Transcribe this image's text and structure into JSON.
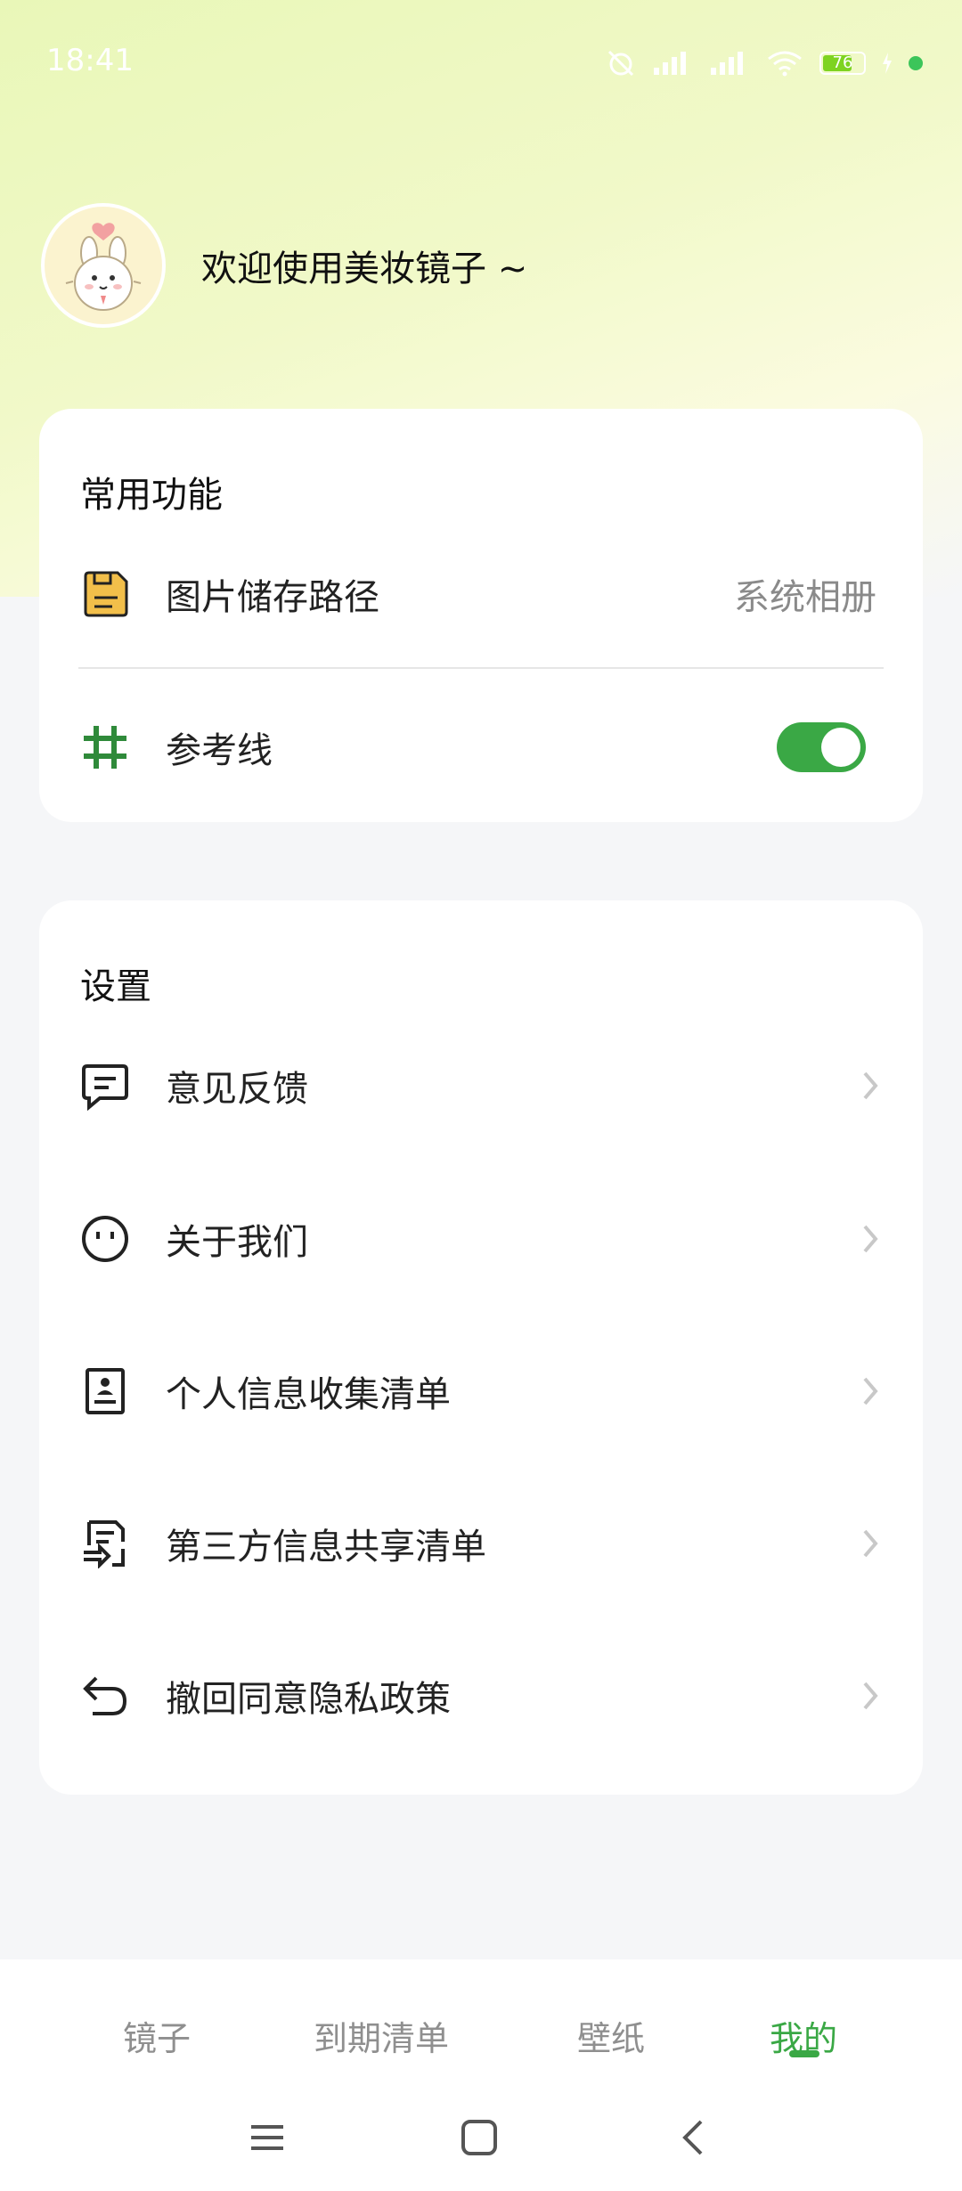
{
  "status_bar": {
    "time": "18:41",
    "battery_level": "76",
    "icons": [
      "alarm-off-icon",
      "signal-icon",
      "signal-icon",
      "wifi-icon",
      "battery-icon",
      "charging-icon",
      "dot-icon"
    ]
  },
  "header": {
    "welcome_text": "欢迎使用美妆镜子 ~",
    "avatar_icon": "bunny-avatar"
  },
  "common_functions": {
    "title": "常用功能",
    "items": [
      {
        "label": "图片储存路径",
        "value": "系统相册",
        "icon": "save-icon"
      },
      {
        "label": "参考线",
        "icon": "grid-icon",
        "toggle_on": true
      }
    ]
  },
  "settings": {
    "title": "设置",
    "items": [
      {
        "label": "意见反馈",
        "icon": "message-icon"
      },
      {
        "label": "关于我们",
        "icon": "smile-icon"
      },
      {
        "label": "个人信息收集清单",
        "icon": "id-card-icon"
      },
      {
        "label": "第三方信息共享清单",
        "icon": "share-document-icon"
      },
      {
        "label": "撤回同意隐私政策",
        "icon": "undo-icon"
      }
    ]
  },
  "bottom_nav": {
    "tabs": [
      {
        "label": "镜子",
        "active": false
      },
      {
        "label": "到期清单",
        "active": false
      },
      {
        "label": "壁纸",
        "active": false
      },
      {
        "label": "我的",
        "active": true
      }
    ]
  },
  "colors": {
    "accent": "#3aa845",
    "save_icon_fill": "#f2bf4a",
    "grid_icon": "#2f8a3a"
  }
}
